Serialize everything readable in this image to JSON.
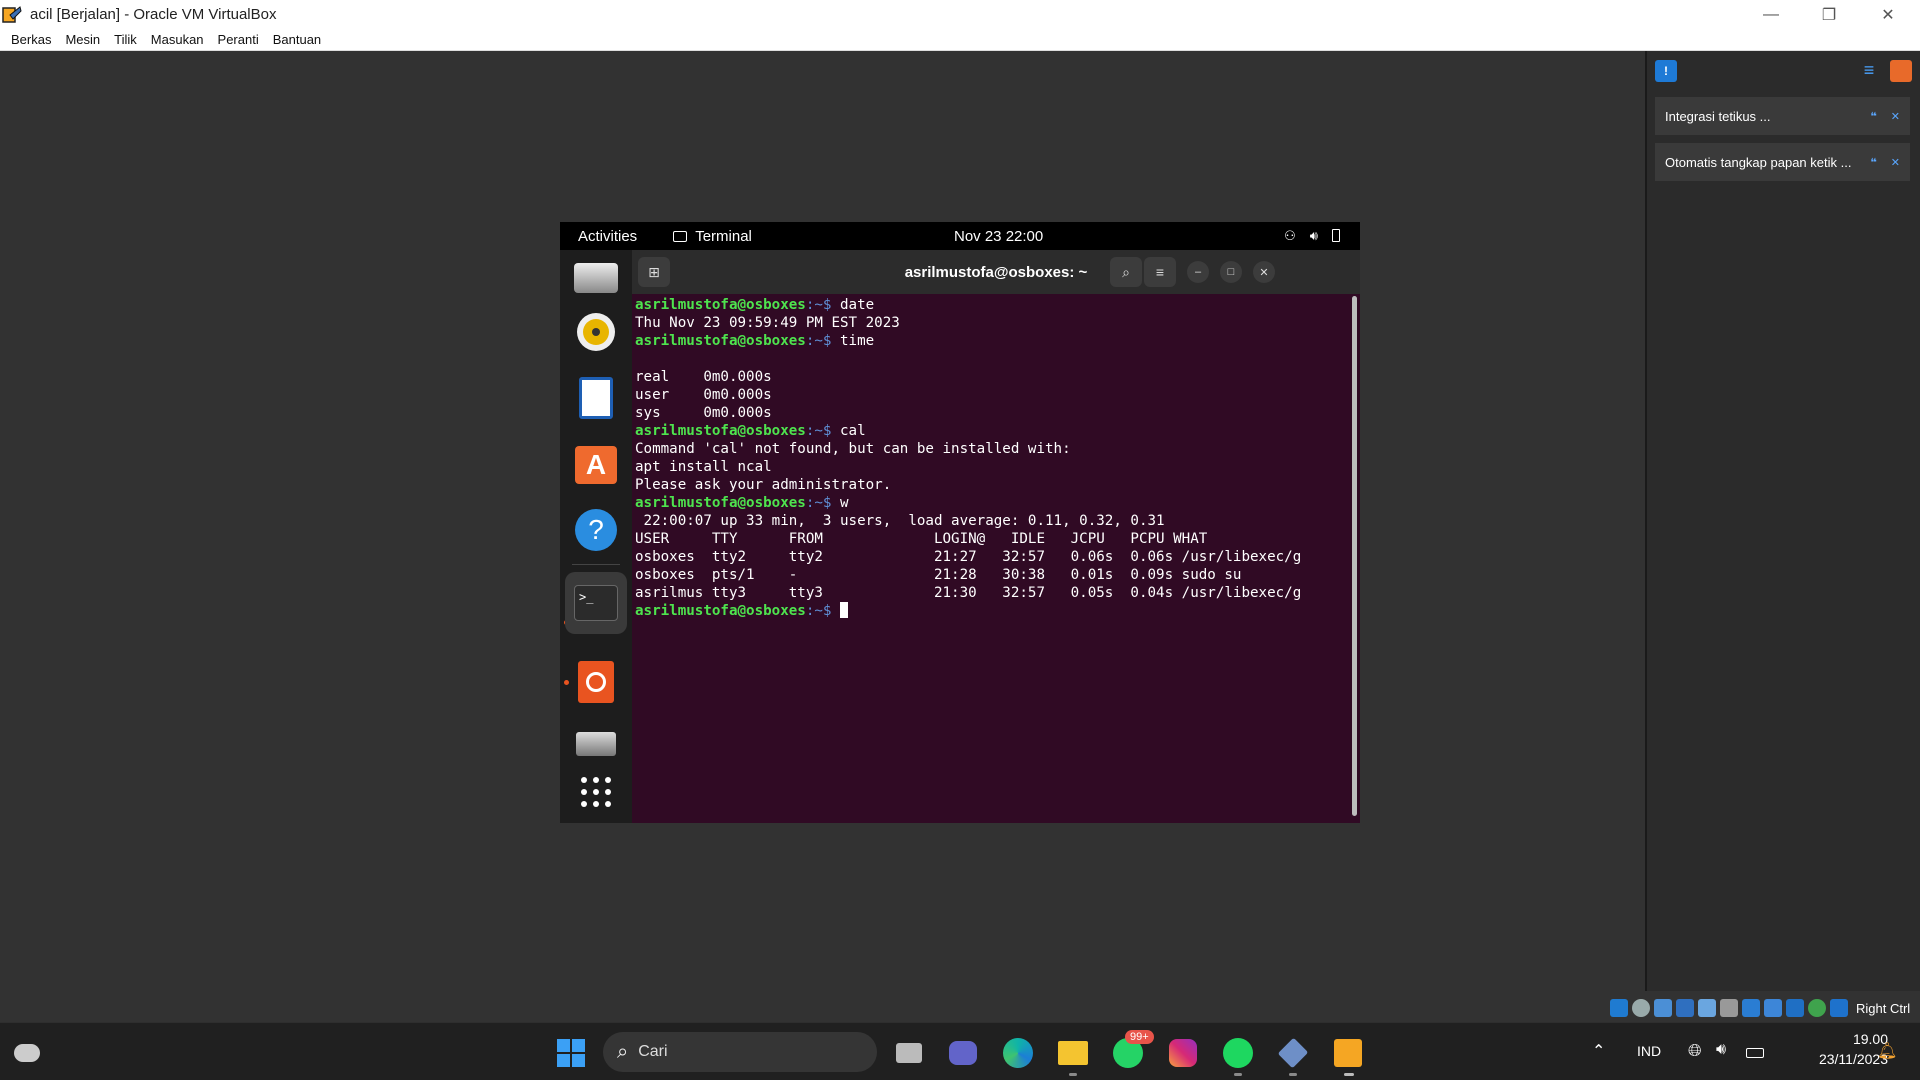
{
  "host_window": {
    "title": "acil [Berjalan] - Oracle VM VirtualBox",
    "controls": [
      "minimize-icon",
      "restore-icon",
      "close-icon"
    ]
  },
  "menu": {
    "items": [
      "Berkas",
      "Mesin",
      "Tilik",
      "Masukan",
      "Peranti",
      "Bantuan"
    ]
  },
  "notifications": [
    {
      "text": "Integrasi tetikus ..."
    },
    {
      "text": "Otomatis tangkap papan ketik ..."
    }
  ],
  "statusbar": {
    "host_key": "Right Ctrl"
  },
  "gnome_topbar": {
    "activities": "Activities",
    "app": "Terminal",
    "clock": "Nov 23  22:00"
  },
  "dock": {
    "items": [
      "files-icon",
      "rhythmbox-icon",
      "writer-icon",
      "software-center-icon",
      "help-icon",
      "terminal-icon",
      "ubuntu-icon",
      "disk-icon",
      "app-grid-icon"
    ]
  },
  "terminal": {
    "title": "asrilmustofa@osboxes: ~",
    "lines": [
      {
        "prompt": "asrilmustofa@osboxes",
        "path": ":~$ ",
        "cmd": "date"
      },
      {
        "out": "Thu Nov 23 09:59:49 PM EST 2023"
      },
      {
        "prompt": "asrilmustofa@osboxes",
        "path": ":~$ ",
        "cmd": "time"
      },
      {
        "out": ""
      },
      {
        "out": "real    0m0.000s"
      },
      {
        "out": "user    0m0.000s"
      },
      {
        "out": "sys     0m0.000s"
      },
      {
        "prompt": "asrilmustofa@osboxes",
        "path": ":~$ ",
        "cmd": "cal"
      },
      {
        "out": "Command 'cal' not found, but can be installed with:"
      },
      {
        "out": "apt install ncal"
      },
      {
        "out": "Please ask your administrator."
      },
      {
        "prompt": "asrilmustofa@osboxes",
        "path": ":~$ ",
        "cmd": "w"
      },
      {
        "out": " 22:00:07 up 33 min,  3 users,  load average: 0.11, 0.32, 0.31"
      },
      {
        "out": "USER     TTY      FROM             LOGIN@   IDLE   JCPU   PCPU WHAT"
      },
      {
        "out": "osboxes  tty2     tty2             21:27   32:57   0.06s  0.06s /usr/libexec/g"
      },
      {
        "out": "osboxes  pts/1    -                21:28   30:38   0.01s  0.09s sudo su"
      },
      {
        "out": "asrilmus tty3     tty3             21:30   32:57   0.05s  0.04s /usr/libexec/g"
      },
      {
        "prompt": "asrilmustofa@osboxes",
        "path": ":~$ ",
        "cmd": "",
        "cursor": true
      }
    ]
  },
  "taskbar": {
    "search_placeholder": "Cari",
    "whatsapp_badge": "99+",
    "language": "IND",
    "time": "19.00",
    "date": "23/11/2023"
  }
}
